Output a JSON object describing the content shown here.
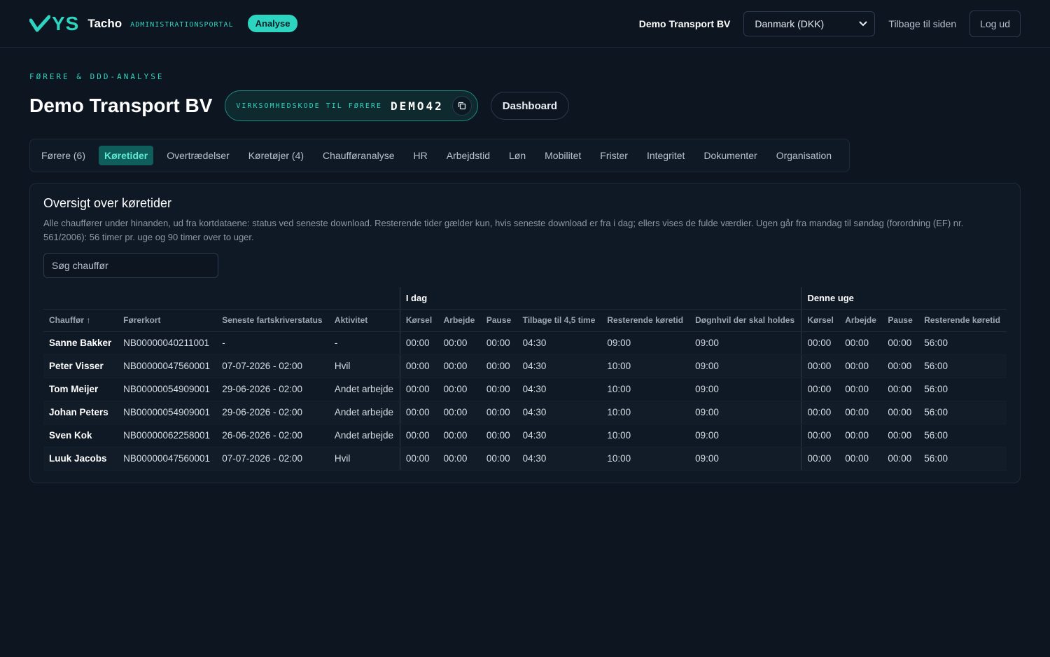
{
  "header": {
    "logo_text": "YS",
    "brand": "Tacho",
    "brand_sub": "ADMINISTRATIONSPORTAL",
    "badge": "Analyse",
    "company": "Demo Transport BV",
    "country_select": "Danmark (DKK)",
    "back_link": "Tilbage til siden",
    "logout": "Log ud"
  },
  "page": {
    "eyebrow": "FØRERE & DDD-ANALYSE",
    "title": "Demo Transport BV",
    "code_label": "VIRKSOMHEDSKODE TIL FØRERE",
    "code_value": "DEMO42",
    "dashboard_button": "Dashboard"
  },
  "tabs": [
    {
      "label": "Førere (6)",
      "active": false
    },
    {
      "label": "Køretider",
      "active": true
    },
    {
      "label": "Overtrædelser",
      "active": false
    },
    {
      "label": "Køretøjer (4)",
      "active": false
    },
    {
      "label": "Chaufføranalyse",
      "active": false
    },
    {
      "label": "HR",
      "active": false
    },
    {
      "label": "Arbejdstid",
      "active": false
    },
    {
      "label": "Løn",
      "active": false
    },
    {
      "label": "Mobilitet",
      "active": false
    },
    {
      "label": "Frister",
      "active": false
    },
    {
      "label": "Integritet",
      "active": false
    },
    {
      "label": "Dokumenter",
      "active": false
    },
    {
      "label": "Organisation",
      "active": false
    }
  ],
  "card": {
    "title": "Oversigt over køretider",
    "description": "Alle chauffører under hinanden, ud fra kortdataene: status ved seneste download. Resterende tider gælder kun, hvis seneste download er fra i dag; ellers vises de fulde værdier. Ugen går fra mandag til søndag (forordning (EF) nr. 561/2006): 56 timer pr. uge og 90 timer over to uger.",
    "search_placeholder": "Søg chauffør"
  },
  "table": {
    "group_today": "I dag",
    "group_week": "Denne uge",
    "columns": [
      "Chauffør ↑",
      "Førerkort",
      "Seneste fartskriverstatus",
      "Aktivitet",
      "Kørsel",
      "Arbejde",
      "Pause",
      "Tilbage til 4,5 time",
      "Resterende køretid",
      "Døgnhvil der skal holdes",
      "Kørsel",
      "Arbejde",
      "Pause",
      "Resterende køretid"
    ],
    "rows": [
      [
        "Sanne Bakker",
        "NB00000040211001",
        "-",
        "-",
        "00:00",
        "00:00",
        "00:00",
        "04:30",
        "09:00",
        "09:00",
        "00:00",
        "00:00",
        "00:00",
        "56:00"
      ],
      [
        "Peter Visser",
        "NB00000047560001",
        "07-07-2026 - 02:00",
        "Hvil",
        "00:00",
        "00:00",
        "00:00",
        "04:30",
        "10:00",
        "09:00",
        "00:00",
        "00:00",
        "00:00",
        "56:00"
      ],
      [
        "Tom Meijer",
        "NB00000054909001",
        "29-06-2026 - 02:00",
        "Andet arbejde",
        "00:00",
        "00:00",
        "00:00",
        "04:30",
        "10:00",
        "09:00",
        "00:00",
        "00:00",
        "00:00",
        "56:00"
      ],
      [
        "Johan Peters",
        "NB00000054909001",
        "29-06-2026 - 02:00",
        "Andet arbejde",
        "00:00",
        "00:00",
        "00:00",
        "04:30",
        "10:00",
        "09:00",
        "00:00",
        "00:00",
        "00:00",
        "56:00"
      ],
      [
        "Sven Kok",
        "NB00000062258001",
        "26-06-2026 - 02:00",
        "Andet arbejde",
        "00:00",
        "00:00",
        "00:00",
        "04:30",
        "10:00",
        "09:00",
        "00:00",
        "00:00",
        "00:00",
        "56:00"
      ],
      [
        "Luuk Jacobs",
        "NB00000047560001",
        "07-07-2026 - 02:00",
        "Hvil",
        "00:00",
        "00:00",
        "00:00",
        "04:30",
        "10:00",
        "09:00",
        "00:00",
        "00:00",
        "00:00",
        "56:00"
      ]
    ]
  },
  "colors": {
    "accent": "#2dd4bf",
    "background": "#0d1521",
    "active_tab_bg": "#0f5e5b"
  }
}
